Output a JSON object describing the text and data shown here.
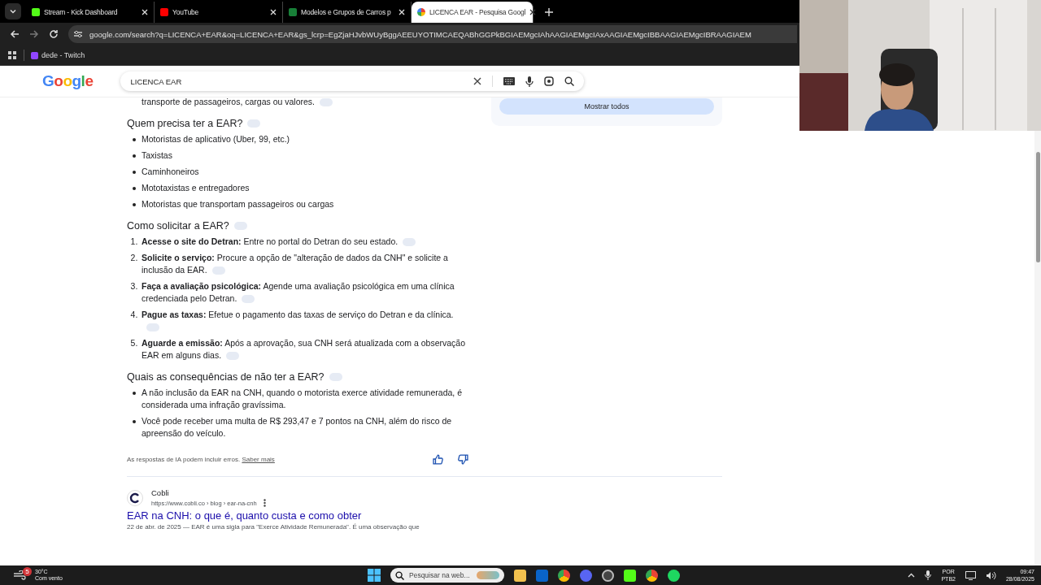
{
  "tabs": [
    {
      "title": "Stream - Kick Dashboard",
      "selected": false
    },
    {
      "title": "YouTube",
      "selected": false
    },
    {
      "title": "Modelos e Grupos de Carros p",
      "selected": false
    },
    {
      "title": "LICENCA EAR - Pesquisa Googl",
      "selected": true
    }
  ],
  "address": "google.com/search?q=LICENCA+EAR&oq=LICENCA+EAR&gs_lcrp=EgZjaHJvbWUyBggAEEUYOTIMCAEQABhGGPkBGIAEMgcIAhAAGIAEMgcIAxAAGIAEMgcIBBAAGIAEMgcIBRAAGIAEM",
  "bookmarks": [
    {
      "label": "dede - Twitch"
    }
  ],
  "logo": "Google",
  "search": {
    "value": "LICENCA EAR"
  },
  "right_panel": {
    "button": "Mostrar todos"
  },
  "overview": {
    "lead_line": "transporte de passageiros, cargas ou valores.",
    "sections": [
      {
        "heading": "Quem precisa ter a EAR?",
        "kind": "bullets",
        "items": [
          "Motoristas de aplicativo (Uber, 99, etc.)",
          "Taxistas",
          "Caminhoneiros",
          "Mototaxistas e entregadores",
          "Motoristas que transportam passageiros ou cargas"
        ]
      },
      {
        "heading": "Como solicitar a EAR?",
        "kind": "numbered",
        "numbers": [
          "1.",
          "2.",
          "3.",
          "4.",
          "5."
        ],
        "items": [
          "**Acesse o site do Detran:** Entre no portal do Detran do seu estado.",
          "**Solicite o serviço:** Procure a opção de \"alteração de dados da CNH\" e solicite a inclusão da EAR.",
          "**Faça a avaliação psicológica:** Agende uma avaliação psicológica em uma clínica credenciada pelo Detran.",
          "**Pague as taxas:** Efetue o pagamento das taxas de serviço do Detran e da clínica.",
          "**Aguarde a emissão:** Após a aprovação, sua CNH será atualizada com a observação EAR em alguns dias."
        ]
      },
      {
        "heading": "Quais as consequências de não ter a EAR?",
        "kind": "bullets",
        "items": [
          "A não inclusão da EAR na CNH, quando o motorista exerce atividade remunerada, é considerada uma infração gravíssima.",
          "Você pode receber uma multa de R$ 293,47 e 7 pontos na CNH, além do risco de apreensão do veículo."
        ]
      }
    ],
    "disclaimer": "As respostas de IA podem incluir erros.",
    "learn_more": "Saber mais"
  },
  "result": {
    "site": "Cobli",
    "path": "https://www.cobli.co › blog › ear-na-cnh",
    "title": "EAR na CNH: o que é, quanto custa e como obter",
    "snippet": "22 de abr. de 2025 — EAR é uma sigla para \"Exerce Atividade Remunerada\". É uma observação que"
  },
  "taskbar": {
    "weather_badge": "5",
    "temperature": "30°C",
    "weather": "Com vento",
    "search_placeholder": "Pesquisar na web...",
    "lang": "POR",
    "layout": "PTB2",
    "time": "09:47",
    "date": "28/08/2025"
  }
}
